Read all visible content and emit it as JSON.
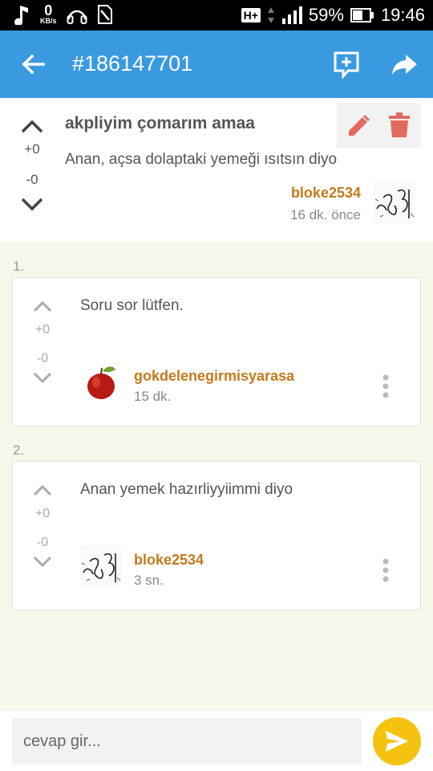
{
  "status_bar": {
    "speed_value": "0",
    "speed_unit": "KB/s",
    "network_label": "H+",
    "battery": "59%",
    "time": "19:46"
  },
  "app_bar": {
    "title": "#186147701",
    "icons": [
      "back-arrow-icon",
      "add-comment-icon",
      "share-icon"
    ]
  },
  "question": {
    "title": "akpliyim çomarım amaa",
    "body": "Anan, açsa dolaptaki yemeği ısıtsın diyo",
    "upvotes": "+0",
    "downvotes": "-0",
    "author": "bloke2534",
    "time": "16 dk. önce",
    "action_colors": {
      "icons": "#e36a5e"
    }
  },
  "answers": [
    {
      "number": "1.",
      "body": "Soru sor lütfen.",
      "upvotes": "+0",
      "downvotes": "-0",
      "author": "gokdelenegirmisyarasa",
      "time": "15 dk.",
      "avatar": "apple-avatar"
    },
    {
      "number": "2.",
      "body": "Anan yemek hazırliyyiimmi diyo",
      "upvotes": "+0",
      "downvotes": "-0",
      "author": "bloke2534",
      "time": "3 sn.",
      "avatar": "scribble-avatar"
    }
  ],
  "reply": {
    "placeholder": "cevap gir...",
    "send_color": "#f5c30f"
  },
  "colors": {
    "app_bar": "#3a9ae0",
    "author": "#c47a1c",
    "background": "#f8f7ec"
  }
}
